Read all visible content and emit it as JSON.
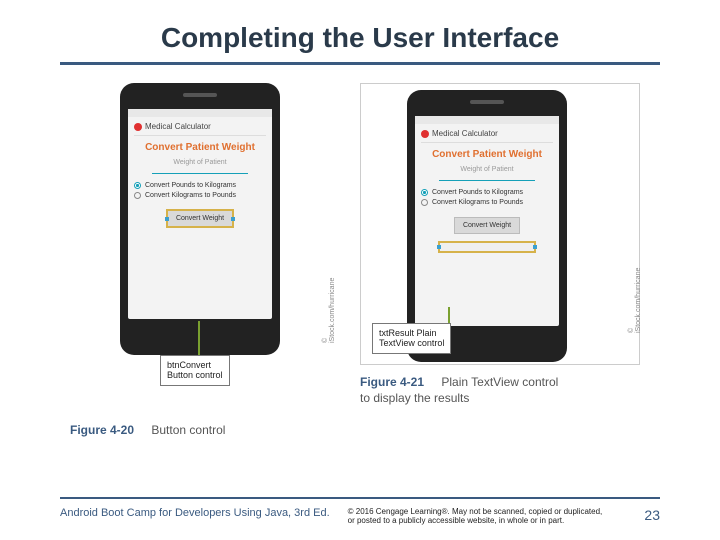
{
  "title": "Completing the User Interface",
  "figures": {
    "left": {
      "phone": {
        "app_title": "Medical Calculator",
        "heading": "Convert Patient Weight",
        "subheading": "Weight of Patient",
        "radio1": "Convert Pounds to Kilograms",
        "radio2": "Convert Kilograms to Pounds",
        "button": "Convert Weight"
      },
      "callout": "btnConvert\nButton control",
      "credit": "© iStock.com/hurricane",
      "caption_num": "Figure 4-20",
      "caption_txt": "Button control"
    },
    "right": {
      "phone": {
        "app_title": "Medical Calculator",
        "heading": "Convert Patient Weight",
        "subheading": "Weight of Patient",
        "radio1": "Convert Pounds to Kilograms",
        "radio2": "Convert Kilograms to Pounds",
        "button": "Convert Weight"
      },
      "callout": "txtResult Plain\nTextView control",
      "credit": "© iStock.com/hurricane",
      "caption_num": "Figure 4-21",
      "caption_txt": "Plain TextView control",
      "caption_desc": "to display the results"
    }
  },
  "footer": {
    "book": "Android Boot Camp for Developers Using Java, 3rd Ed.",
    "copyright": "© 2016 Cengage Learning®. May not be scanned, copied or duplicated, or posted to a publicly accessible website, in whole or in part.",
    "page": "23"
  }
}
